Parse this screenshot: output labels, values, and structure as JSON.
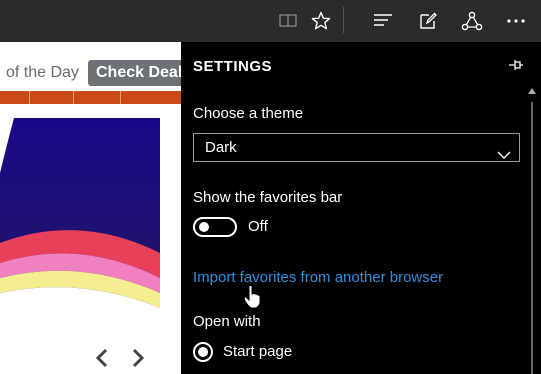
{
  "toolbar": {
    "icons": [
      "reading-view-icon",
      "favorites-star-icon",
      "hub-icon",
      "web-note-icon",
      "share-icon",
      "more-icon"
    ]
  },
  "webpage": {
    "deal_text": "of the Day",
    "deal_button": "Check Deal",
    "colors": {
      "banner_top": "#1a0a8a",
      "orange": "#c94a14"
    }
  },
  "settings": {
    "title": "SETTINGS",
    "theme_label": "Choose a theme",
    "theme_value": "Dark",
    "favorites_bar_label": "Show the favorites bar",
    "favorites_bar_state": "Off",
    "import_link": "Import favorites from another browser",
    "open_with_label": "Open with",
    "open_with_option": "Start page"
  },
  "colors": {
    "panel_bg": "#000000",
    "link": "#2f8fdc",
    "toolbar_bg": "#2b2b2b"
  }
}
